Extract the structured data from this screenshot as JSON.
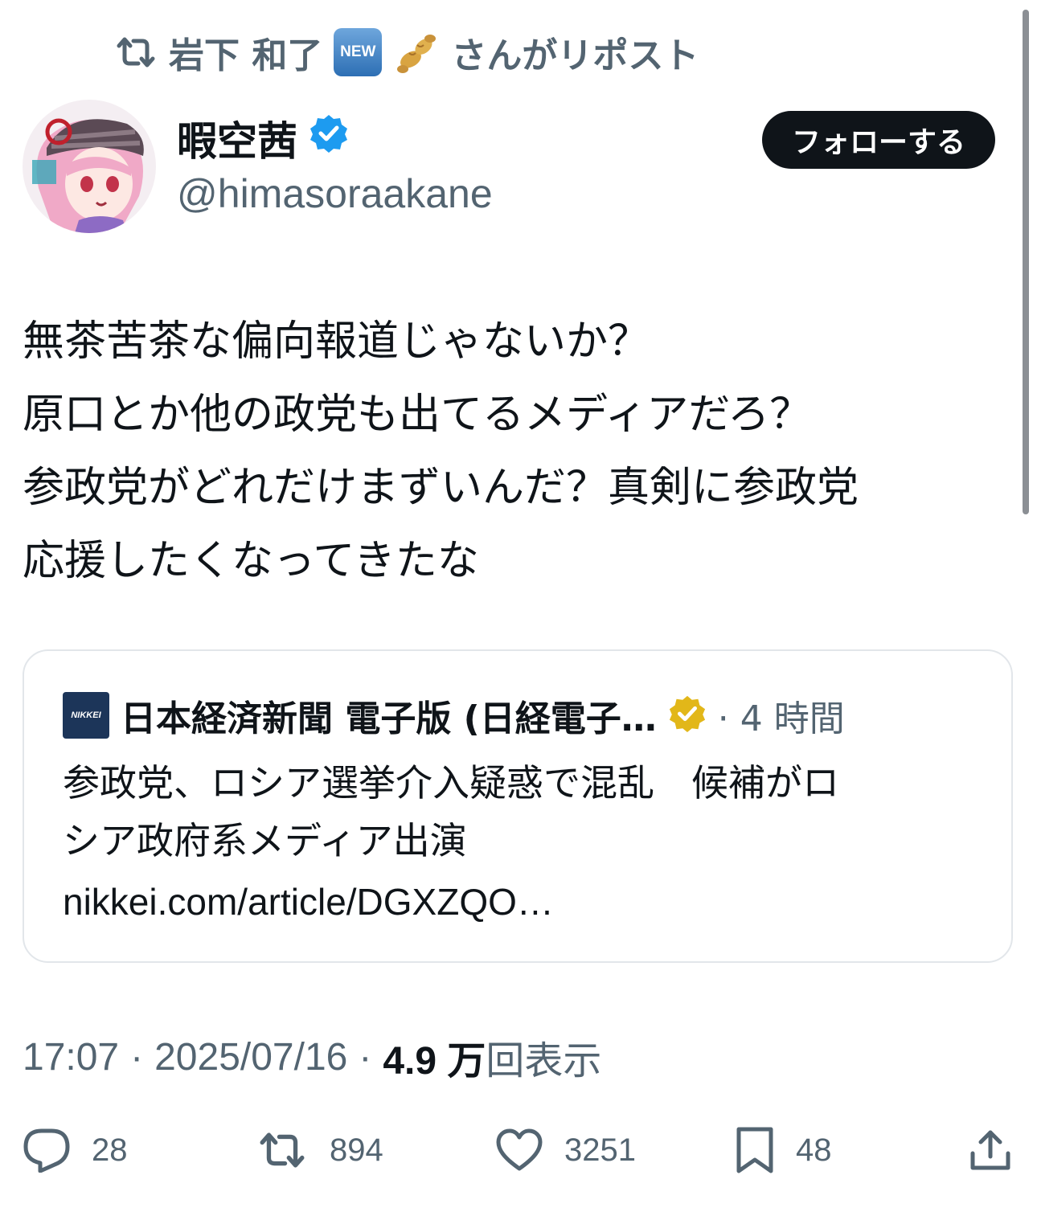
{
  "repost": {
    "reposter_name": "岩下 和了",
    "badge_label": "NEW",
    "suffix": "さんがリポスト"
  },
  "author": {
    "display_name": "暇空茜",
    "handle": "@himasoraakane",
    "verified": true,
    "follow_label": "フォローする"
  },
  "tweet": {
    "lines": [
      "無茶苦茶な偏向報道じゃないか？",
      "原口とか他の政党も出てるメディアだろ？",
      "参政党がどれだけまずいんだ？真剣に参政党",
      "応援したくなってきたな"
    ]
  },
  "quote": {
    "logo_text": "NIKKEI",
    "source_name": "日本経済新聞 電子版 (日経電子…",
    "time": "· 4 時間",
    "text_lines": [
      "参政党、ロシア選挙介入疑惑で混乱　候補がロ",
      "シア政府系メディア出演"
    ],
    "link": "nikkei.com/article/DGXZQO…"
  },
  "meta": {
    "time": "17:07",
    "sep1": "·",
    "date": "2025/07/16",
    "sep2": "·",
    "views_number": "4.9 万",
    "views_label": "回表示"
  },
  "actions": {
    "replies": "28",
    "reposts": "894",
    "likes": "3251",
    "bookmarks": "48"
  },
  "colors": {
    "text": "#0f1419",
    "secondary": "#536471",
    "verified_blue": "#1d9bf0",
    "verified_gold": "#e2b719",
    "nikkei_blue": "#1c3559"
  }
}
